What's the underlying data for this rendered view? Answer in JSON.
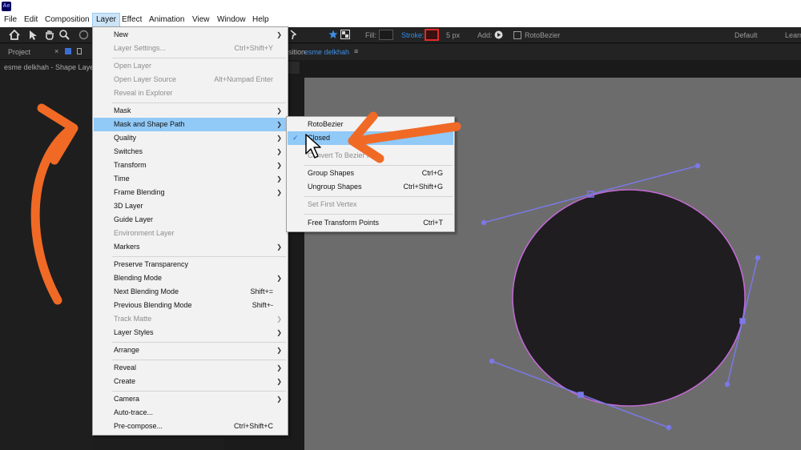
{
  "titlebar": {
    "app_logo": "Ae"
  },
  "menubar": {
    "items": [
      "File",
      "Edit",
      "Composition",
      "Layer",
      "Effect",
      "Animation",
      "View",
      "Window",
      "Help"
    ],
    "active": "Layer"
  },
  "toolbar": {
    "fill_label": "Fill:",
    "stroke_label": "Stroke:",
    "stroke_width": "5 px",
    "add_label": "Add:",
    "rotobezier_label": "RotoBezier",
    "workspace_default": "Default",
    "workspace_learn": "Learn",
    "icons": [
      "home-icon",
      "selection-arrow-icon",
      "hand-icon",
      "zoom-icon",
      "rotate-icon",
      "pin-icon",
      "star-icon",
      "checker-icon",
      "add-circle-icon"
    ]
  },
  "project_panel": {
    "tab_label": "Project",
    "close_glyph": "×",
    "subtitle": "esme delkhah - Shape Layer"
  },
  "composition_panel": {
    "tab_prefix": "sition",
    "tab_name": "esme delkhah",
    "menu_glyph": "≡"
  },
  "layer_menu": {
    "items": [
      {
        "label": "New",
        "submenu": true
      },
      {
        "label": "Layer Settings...",
        "shortcut": "Ctrl+Shift+Y",
        "disabled": true
      },
      {
        "label": "Open Layer",
        "disabled": true
      },
      {
        "label": "Open Layer Source",
        "shortcut": "Alt+Numpad Enter",
        "disabled": true
      },
      {
        "label": "Reveal in Explorer",
        "disabled": true
      },
      {
        "label": "Mask",
        "submenu": true
      },
      {
        "label": "Mask and Shape Path",
        "submenu": true,
        "highlight": true
      },
      {
        "label": "Quality",
        "submenu": true
      },
      {
        "label": "Switches",
        "submenu": true
      },
      {
        "label": "Transform",
        "submenu": true
      },
      {
        "label": "Time",
        "submenu": true
      },
      {
        "label": "Frame Blending",
        "submenu": true
      },
      {
        "label": "3D Layer"
      },
      {
        "label": "Guide Layer"
      },
      {
        "label": "Environment Layer",
        "disabled": true
      },
      {
        "label": "Markers",
        "submenu": true
      },
      {
        "label": "Preserve Transparency"
      },
      {
        "label": "Blending Mode",
        "submenu": true
      },
      {
        "label": "Next Blending Mode",
        "shortcut": "Shift+="
      },
      {
        "label": "Previous Blending Mode",
        "shortcut": "Shift+-"
      },
      {
        "label": "Track Matte",
        "submenu": true,
        "disabled": true
      },
      {
        "label": "Layer Styles",
        "submenu": true
      },
      {
        "label": "Arrange",
        "submenu": true
      },
      {
        "label": "Reveal",
        "submenu": true
      },
      {
        "label": "Create",
        "submenu": true
      },
      {
        "label": "Camera",
        "submenu": true
      },
      {
        "label": "Auto-trace..."
      },
      {
        "label": "Pre-compose...",
        "shortcut": "Ctrl+Shift+C"
      }
    ]
  },
  "mask_shape_submenu": {
    "items": [
      {
        "label": "RotoBezier"
      },
      {
        "label": "Closed",
        "checked": true,
        "highlight": true
      },
      {
        "label": "Convert To Bezier Path",
        "disabled": true
      },
      {
        "label": "Group Shapes",
        "shortcut": "Ctrl+G"
      },
      {
        "label": "Ungroup Shapes",
        "shortcut": "Ctrl+Shift+G"
      },
      {
        "label": "Set First Vertex",
        "disabled": true
      },
      {
        "label": "Free Transform Points",
        "shortcut": "Ctrl+T"
      }
    ],
    "check_glyph": "✓"
  },
  "colors": {
    "highlight": "#91c9f7",
    "annotation_arrow": "#f06a26",
    "path_handle": "#7b78e8",
    "shape_stroke": "#c56ad8",
    "shape_fill": "#1f1d20"
  }
}
